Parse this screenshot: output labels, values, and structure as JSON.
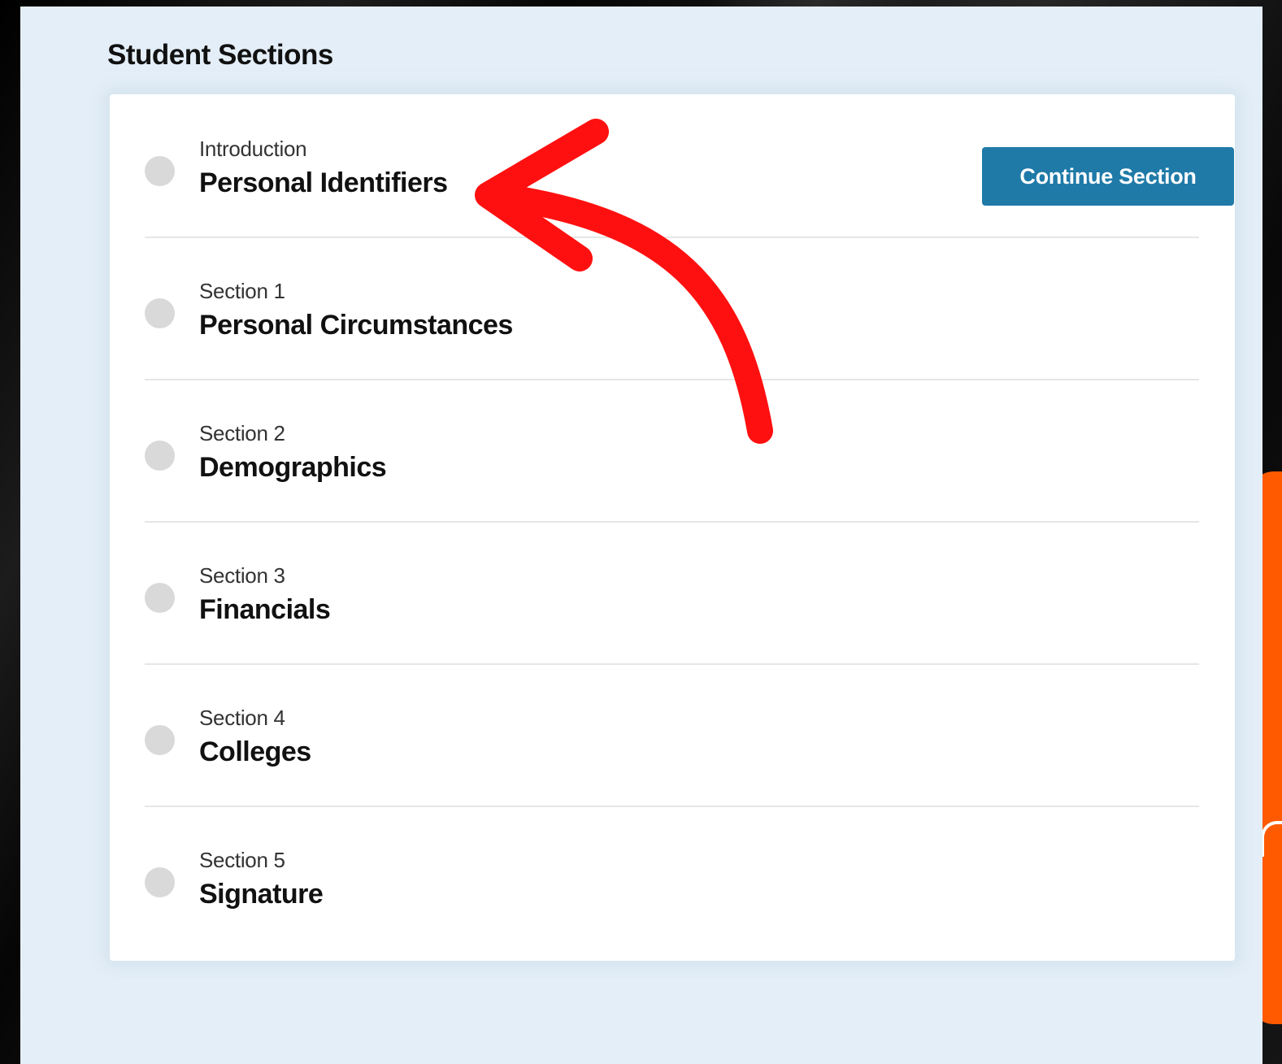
{
  "page": {
    "title": "Student Sections"
  },
  "sections": [
    {
      "kicker": "Introduction",
      "title": "Personal Identifiers"
    },
    {
      "kicker": "Section 1",
      "title": "Personal Circumstances"
    },
    {
      "kicker": "Section 2",
      "title": "Demographics"
    },
    {
      "kicker": "Section 3",
      "title": "Financials"
    },
    {
      "kicker": "Section 4",
      "title": "Colleges"
    },
    {
      "kicker": "Section 5",
      "title": "Signature"
    }
  ],
  "actions": {
    "continue_label": "Continue Section"
  },
  "colors": {
    "button": "#1f7aa8",
    "annotation_arrow": "#ff1010",
    "panel_bg": "#e4eef8",
    "accent_orange": "#ff5a00"
  },
  "icons": {
    "status": "status-circle-icon",
    "annotation": "curved-arrow-icon"
  }
}
